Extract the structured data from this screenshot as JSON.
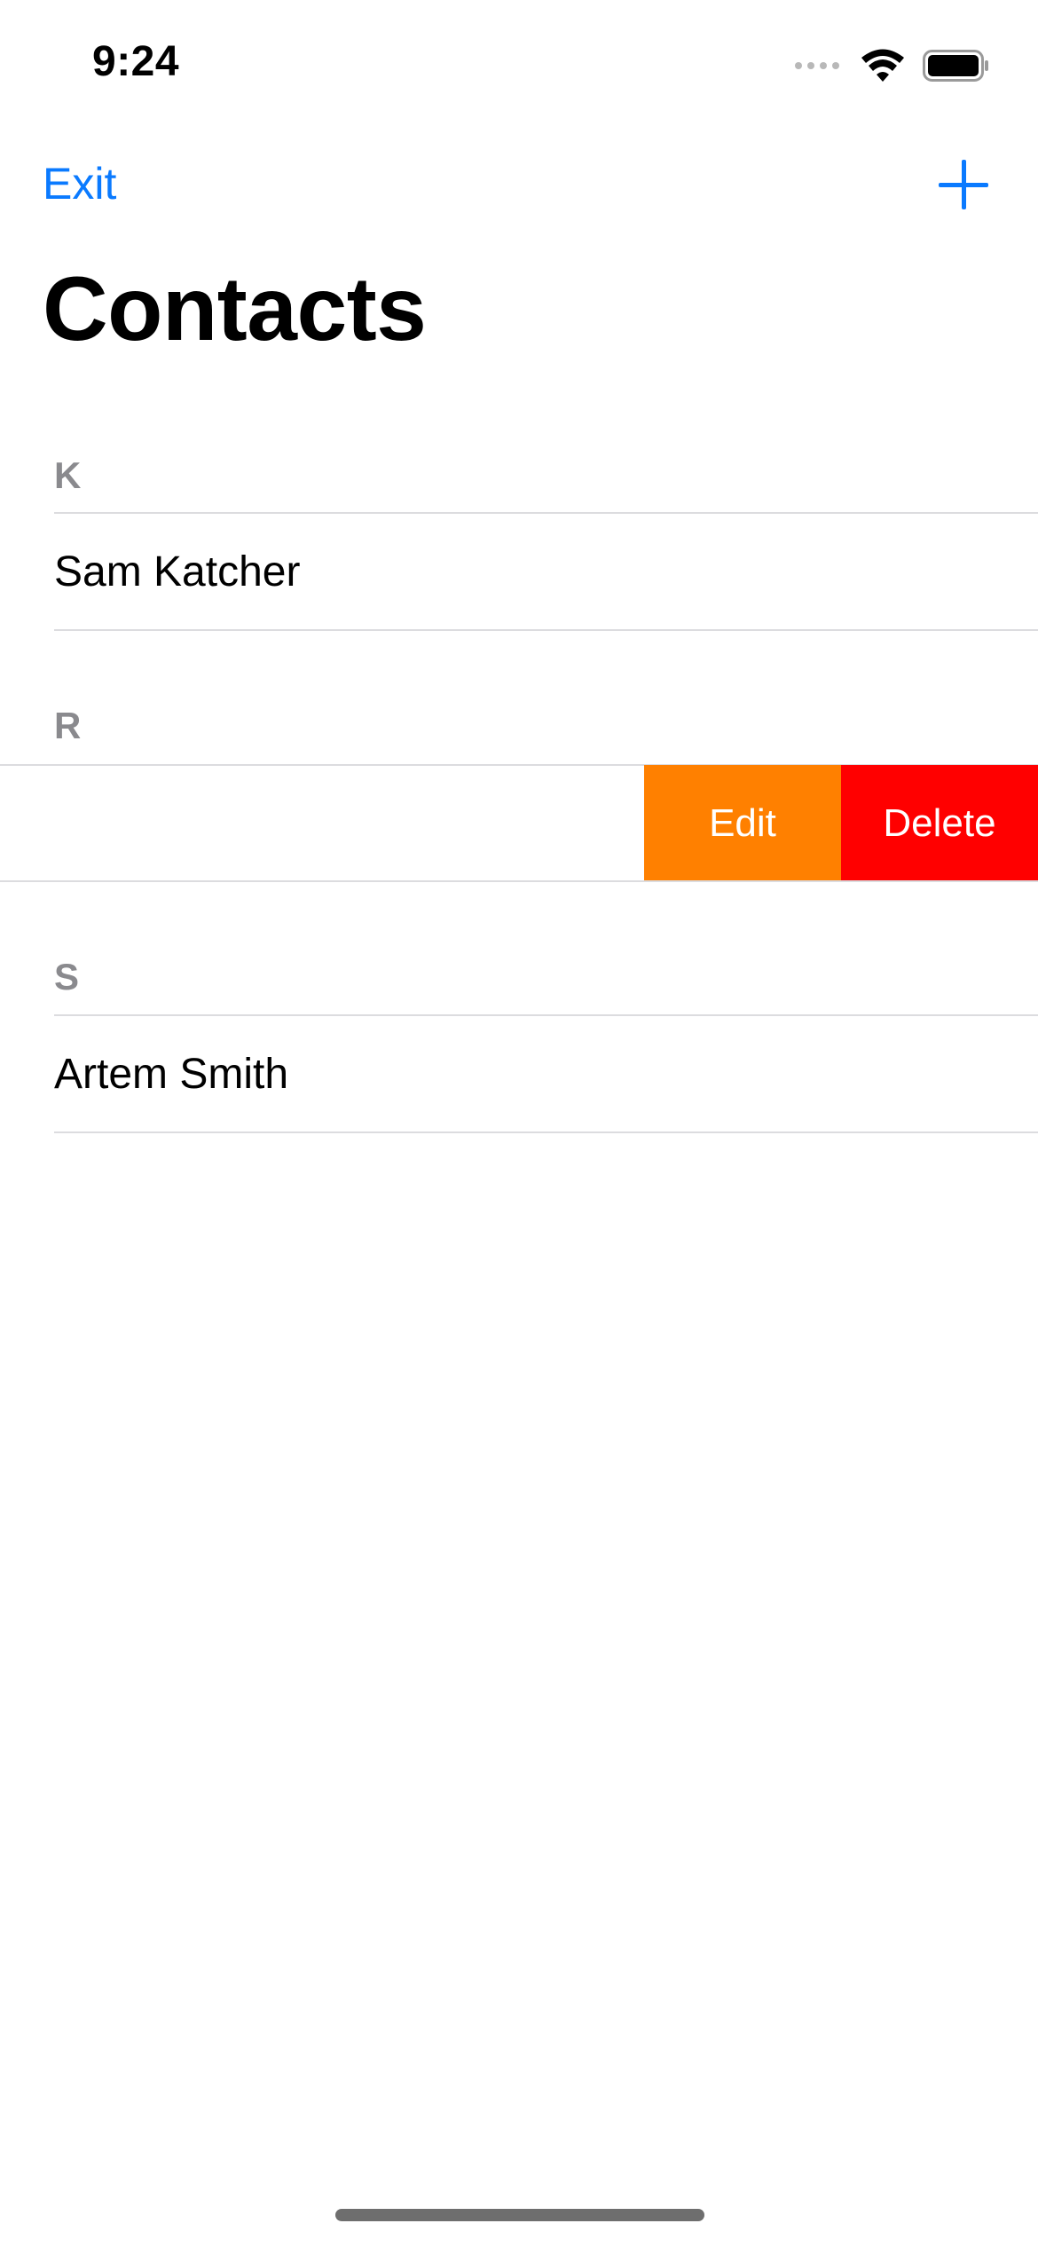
{
  "status_bar": {
    "time": "9:24",
    "icons": [
      "signal-icon",
      "wifi-icon",
      "battery-icon"
    ]
  },
  "nav": {
    "left_button": "Exit",
    "right_icon": "plus-icon",
    "accent_color": "#0a7aff"
  },
  "title": "Contacts",
  "sections": [
    {
      "header": "K",
      "rows": [
        {
          "name": "Sam Katcher"
        }
      ]
    },
    {
      "header": "R",
      "rows": [
        {
          "name": "",
          "swipe_actions": [
            "Edit",
            "Delete"
          ]
        }
      ]
    },
    {
      "header": "S",
      "rows": [
        {
          "name": "Artem Smith"
        }
      ]
    }
  ],
  "swipe_actions": {
    "edit_label": "Edit",
    "edit_color": "#ff8000",
    "delete_label": "Delete",
    "delete_color": "#ff0000"
  }
}
